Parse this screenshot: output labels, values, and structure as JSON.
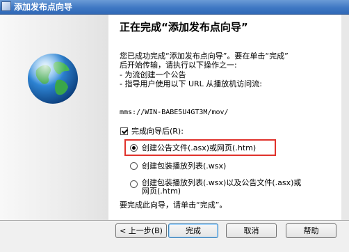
{
  "window": {
    "title": "添加发布点向导"
  },
  "content": {
    "heading": "正在完成“添加发布点向导”",
    "intro_line1": "您已成功完成“添加发布点向导”。要在单击“完成”",
    "intro_line2": "后开始传输，请执行以下操作之一:",
    "bullet1": "- 为流创建一个公告",
    "bullet2": "- 指导用户使用以下 URL 从播放机访问流:",
    "url": "mms://WIN-BABE5U4GT3M/mov/",
    "checkbox_label": "完成向导后(R):",
    "checkbox_checked": true,
    "options": [
      {
        "label": "创建公告文件(.asx)或网页(.htm)",
        "selected": true
      },
      {
        "label": "创建包装播放列表(.wsx)",
        "selected": false
      },
      {
        "label_line1": "创建包装播放列表(.wsx)以及公告文件(.asx)或",
        "label_line2": "网页(.htm)",
        "selected": false
      }
    ],
    "footer": "要完成此向导，请单击“完成”。"
  },
  "buttons": {
    "back": "< 上一步(B)",
    "finish": "完成",
    "cancel": "取消",
    "help": "帮助"
  },
  "colors": {
    "highlight": "#e0322b",
    "titlebar": "#3f78c4"
  }
}
